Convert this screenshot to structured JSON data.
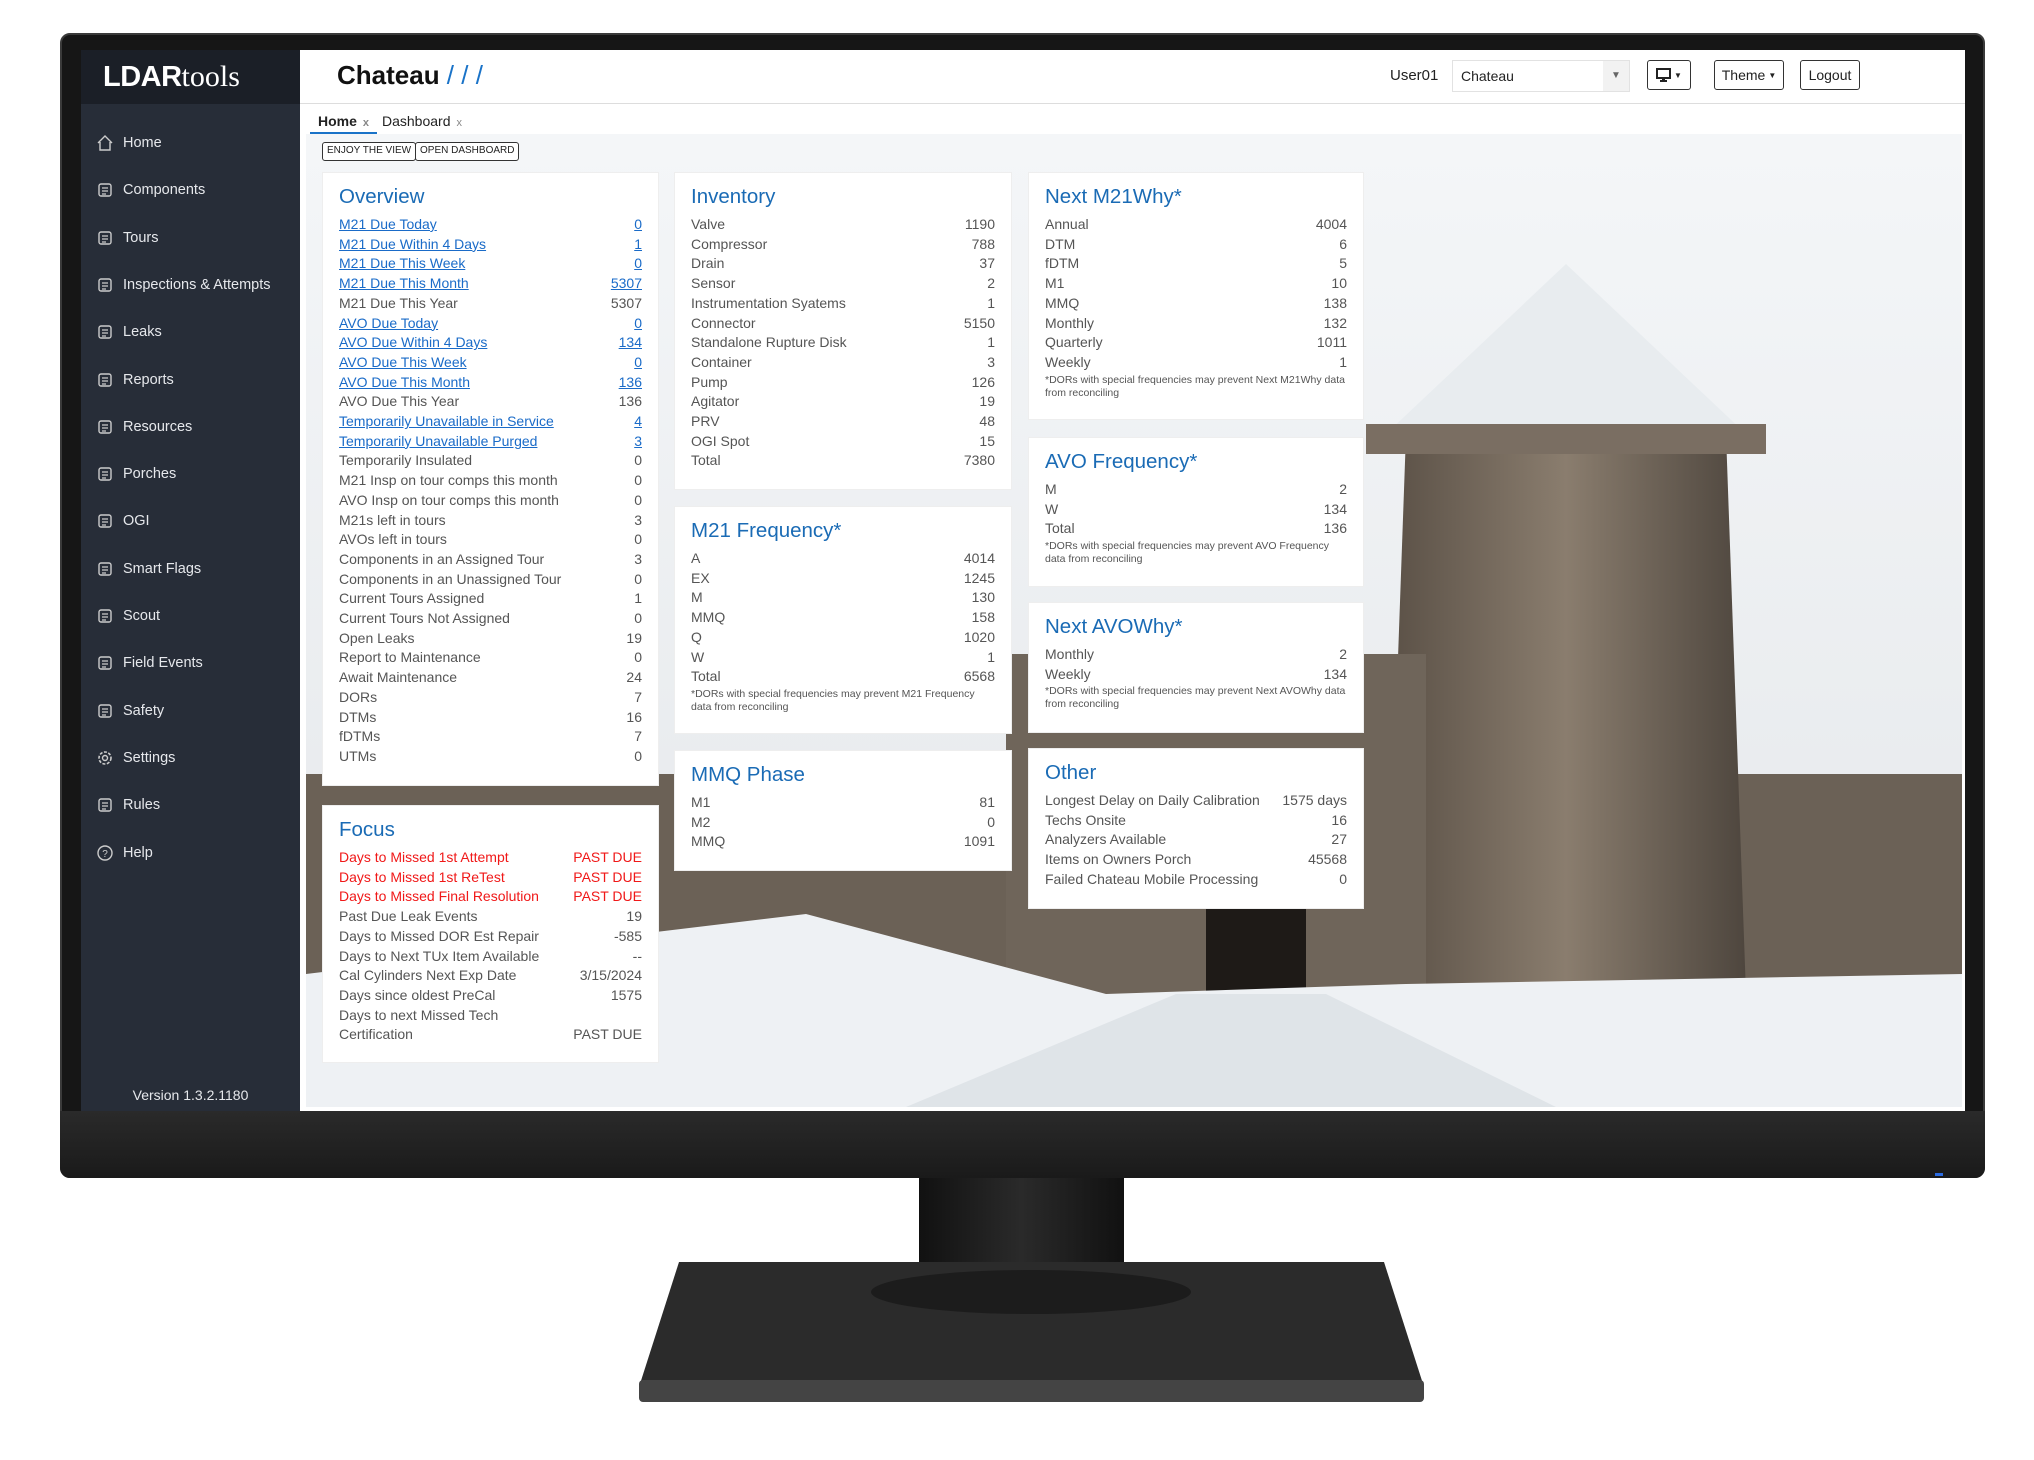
{
  "app": {
    "logo_bold": "LDAR",
    "logo_light": "tools",
    "title": "Chateau",
    "title_suffix": " / / /",
    "version": "Version 1.3.2.1180"
  },
  "header": {
    "user": "User01",
    "site_select": "Chateau",
    "display_icon": "monitor-icon",
    "theme_label": "Theme",
    "logout_label": "Logout"
  },
  "tabs": [
    {
      "label": "Home",
      "active": true
    },
    {
      "label": "Dashboard",
      "active": false
    }
  ],
  "tab_close": "x",
  "buttons": {
    "enjoy": "ENJOY THE VIEW",
    "open_dashboard": "OPEN DASHBOARD"
  },
  "sidebar": {
    "items": [
      {
        "label": "Home",
        "icon": "home-icon"
      },
      {
        "label": "Components",
        "icon": "components-icon"
      },
      {
        "label": "Tours",
        "icon": "tours-icon"
      },
      {
        "label": "Inspections & Attempts",
        "icon": "clipboard-icon"
      },
      {
        "label": "Leaks",
        "icon": "leak-icon"
      },
      {
        "label": "Reports",
        "icon": "chart-icon"
      },
      {
        "label": "Resources",
        "icon": "resources-icon"
      },
      {
        "label": "Porches",
        "icon": "porch-icon"
      },
      {
        "label": "OGI",
        "icon": "camera-icon"
      },
      {
        "label": "Smart Flags",
        "icon": "flag-icon"
      },
      {
        "label": "Scout",
        "icon": "scout-icon"
      },
      {
        "label": "Field Events",
        "icon": "field-events-icon"
      },
      {
        "label": "Safety",
        "icon": "helmet-icon"
      },
      {
        "label": "Settings",
        "icon": "gear-icon"
      },
      {
        "label": "Rules",
        "icon": "rules-icon"
      },
      {
        "label": "Help",
        "icon": "help-icon"
      }
    ]
  },
  "colors": {
    "accent": "#1a6bb5",
    "link": "#1a6bc8",
    "alert": "#f01818",
    "sidebar": "#272d38"
  },
  "cards": {
    "overview": {
      "title": "Overview",
      "rows": [
        [
          "M21 Due Today",
          "0",
          1
        ],
        [
          "M21 Due Within 4 Days",
          "1",
          1
        ],
        [
          "M21 Due This Week",
          "0",
          1
        ],
        [
          "M21 Due This Month",
          "5307",
          1
        ],
        [
          "M21 Due This Year",
          "5307",
          0
        ],
        [
          "AVO Due Today",
          "0",
          1
        ],
        [
          "AVO Due Within 4 Days",
          "134",
          1
        ],
        [
          "AVO Due This Week",
          "0",
          1
        ],
        [
          "AVO Due This Month",
          "136",
          1
        ],
        [
          "AVO Due This Year",
          "136",
          0
        ],
        [
          "Temporarily Unavailable in Service",
          "4",
          1
        ],
        [
          "Temporarily Unavailable Purged",
          "3",
          1
        ],
        [
          "Temporarily Insulated",
          "0",
          0
        ],
        [
          "M21 Insp on tour comps this month",
          "0",
          0
        ],
        [
          "AVO Insp on tour comps this month",
          "0",
          0
        ],
        [
          "M21s left in tours",
          "3",
          0
        ],
        [
          "AVOs left in tours",
          "0",
          0
        ],
        [
          "Components in an Assigned Tour",
          "3",
          0
        ],
        [
          "Components in an Unassigned Tour",
          "0",
          0
        ],
        [
          "Current Tours Assigned",
          "1",
          0
        ],
        [
          "Current Tours Not Assigned",
          "0",
          0
        ],
        [
          "Open Leaks",
          "19",
          0
        ],
        [
          "Report to Maintenance",
          "0",
          0
        ],
        [
          "Await Maintenance",
          "24",
          0
        ],
        [
          "DORs",
          "7",
          0
        ],
        [
          "DTMs",
          "16",
          0
        ],
        [
          "fDTMs",
          "7",
          0
        ],
        [
          "UTMs",
          "0",
          0
        ]
      ]
    },
    "focus": {
      "title": "Focus",
      "rows": [
        [
          "Days to Missed 1st Attempt",
          "PAST DUE",
          2
        ],
        [
          "Days to Missed 1st ReTest",
          "PAST DUE",
          2
        ],
        [
          "Days to Missed Final Resolution",
          "PAST DUE",
          2
        ],
        [
          "Past Due Leak Events",
          "19",
          0
        ],
        [
          "Days to Missed DOR Est Repair",
          "-585",
          0
        ],
        [
          "Days to Next TUx Item Available",
          "--",
          0
        ],
        [
          "Cal Cylinders Next Exp Date",
          "3/15/2024",
          0
        ],
        [
          "Days since oldest PreCal",
          "1575",
          0
        ],
        [
          "Days to next Missed Tech",
          "",
          0
        ],
        [
          "Certification",
          "PAST DUE",
          0
        ]
      ]
    },
    "inventory": {
      "title": "Inventory",
      "rows": [
        [
          "Valve",
          "1190"
        ],
        [
          "Compressor",
          "788"
        ],
        [
          "Drain",
          "37"
        ],
        [
          "Sensor",
          "2"
        ],
        [
          "Instrumentation Syatems",
          "1"
        ],
        [
          "Connector",
          "5150"
        ],
        [
          "Standalone Rupture Disk",
          "1"
        ],
        [
          "Container",
          "3"
        ],
        [
          "Pump",
          "126"
        ],
        [
          "Agitator",
          "19"
        ],
        [
          "PRV",
          "48"
        ],
        [
          "OGI Spot",
          "15"
        ],
        [
          "Total",
          "7380"
        ]
      ]
    },
    "m21freq": {
      "title": "M21 Frequency*",
      "rows": [
        [
          "A",
          "4014"
        ],
        [
          "EX",
          "1245"
        ],
        [
          "M",
          "130"
        ],
        [
          "MMQ",
          "158"
        ],
        [
          "Q",
          "1020"
        ],
        [
          "W",
          "1"
        ],
        [
          "Total",
          "6568"
        ]
      ],
      "note": "*DORs with special frequencies may prevent M21 Frequency data from reconciling"
    },
    "mmq": {
      "title": "MMQ Phase",
      "rows": [
        [
          "M1",
          "81"
        ],
        [
          "M2",
          "0"
        ],
        [
          "MMQ",
          "1091"
        ]
      ]
    },
    "m21why": {
      "title": "Next M21Why*",
      "rows": [
        [
          "Annual",
          "4004"
        ],
        [
          "DTM",
          "6"
        ],
        [
          "fDTM",
          "5"
        ],
        [
          "M1",
          "10"
        ],
        [
          "MMQ",
          "138"
        ],
        [
          "Monthly",
          "132"
        ],
        [
          "Quarterly",
          "1011"
        ],
        [
          "Weekly",
          "1"
        ]
      ],
      "note": "*DORs with special frequencies may prevent Next M21Why data from reconciling"
    },
    "avofreq": {
      "title": "AVO Frequency*",
      "rows": [
        [
          "M",
          "2"
        ],
        [
          "W",
          "134"
        ],
        [
          "Total",
          "136"
        ]
      ],
      "note": "*DORs with special frequencies may prevent AVO Frequency data from reconciling"
    },
    "avowhy": {
      "title": "Next AVOWhy*",
      "rows": [
        [
          "Monthly",
          "2"
        ],
        [
          "Weekly",
          "134"
        ]
      ],
      "note": "*DORs with special frequencies may prevent Next AVOWhy data from reconciling"
    },
    "other": {
      "title": "Other",
      "rows": [
        [
          "Longest Delay on Daily Calibration",
          "1575 days"
        ],
        [
          "Techs Onsite",
          "16"
        ],
        [
          "Analyzers Available",
          "27"
        ],
        [
          "Items on Owners Porch",
          "45568"
        ],
        [
          "Failed Chateau Mobile Processing",
          "0"
        ]
      ]
    }
  }
}
